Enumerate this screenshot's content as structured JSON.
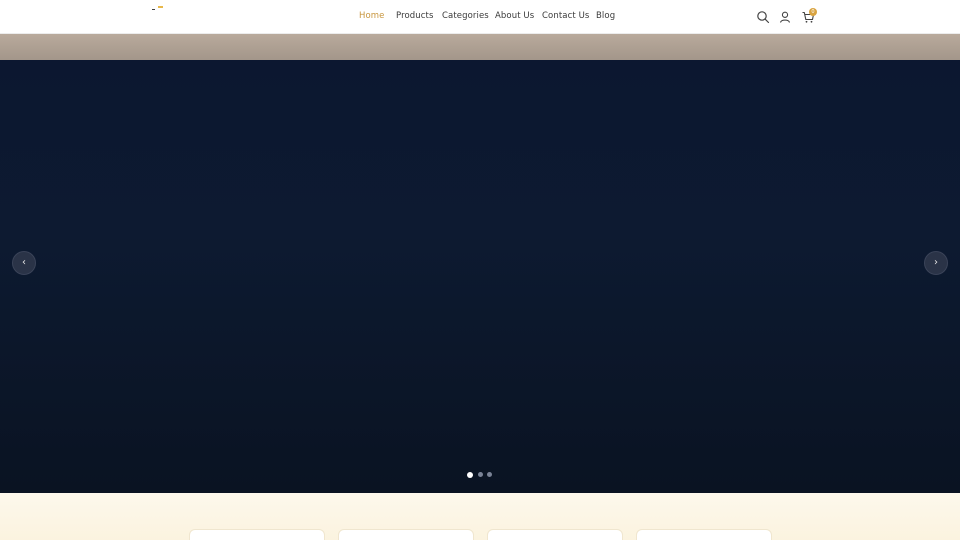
{
  "nav": {
    "items": [
      {
        "label": "Home",
        "active": true
      },
      {
        "label": "Products",
        "active": false
      },
      {
        "label": "Categories",
        "active": false
      },
      {
        "label": "About Us",
        "active": false
      },
      {
        "label": "Contact Us",
        "active": false
      },
      {
        "label": "Blog",
        "active": false
      }
    ]
  },
  "header_icons": {
    "search": "search-icon",
    "account": "user-icon",
    "cart": "cart-icon",
    "cart_count": "0"
  },
  "hero": {
    "prev_icon": "chevron-left-icon",
    "next_icon": "chevron-right-icon",
    "prev_glyph": "‹",
    "next_glyph": "›",
    "slides": 3,
    "active_slide": 1
  },
  "colors": {
    "accent": "#c8963e",
    "hero_bg": "#0c1730",
    "section_bg": "#fdf8ec"
  }
}
